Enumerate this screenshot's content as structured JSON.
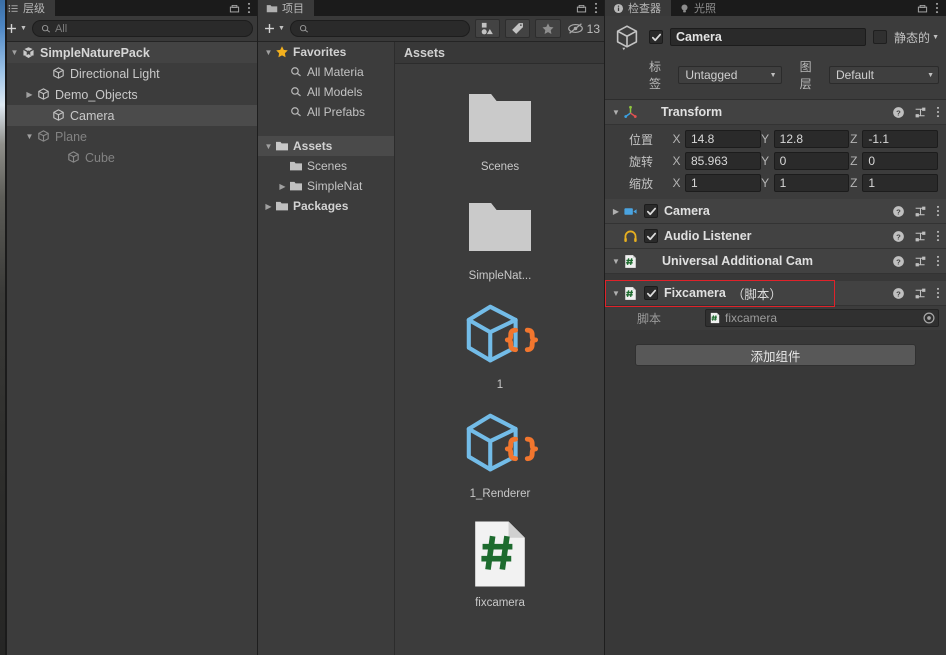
{
  "hierarchy": {
    "tab_label": "层级",
    "tab_icon": "hierarchy-icon",
    "add_label": "+",
    "search_placeholder": "All",
    "search_value": "",
    "items": [
      {
        "label": "SimpleNaturePack",
        "icon": "unity-scene-icon",
        "arrow": "▼",
        "depth": 0,
        "state": "root"
      },
      {
        "label": "Directional Light",
        "icon": "gameobject-cube-icon",
        "arrow": "",
        "depth": 2,
        "state": "normal"
      },
      {
        "label": "Demo_Objects",
        "icon": "gameobject-cube-icon",
        "arrow": "▶",
        "depth": 1,
        "state": "normal"
      },
      {
        "label": "Camera",
        "icon": "gameobject-cube-icon",
        "arrow": "",
        "depth": 2,
        "state": "selected"
      },
      {
        "label": "Plane",
        "icon": "gameobject-cube-icon",
        "arrow": "▼",
        "depth": 1,
        "state": "dim"
      },
      {
        "label": "Cube",
        "icon": "gameobject-cube-icon",
        "arrow": "",
        "depth": 3,
        "state": "dim"
      }
    ]
  },
  "project": {
    "tab_label": "项目",
    "tab_icon": "folder-icon",
    "add_label": "+",
    "search_placeholder": "",
    "search_value": "",
    "toolbar_icons": [
      "type-filter-icon",
      "label-filter-icon",
      "favorites-star-icon"
    ],
    "hidden_count": "13",
    "hidden_icon": "eye-slash-icon",
    "tree": [
      {
        "label": "Favorites",
        "icon": "star-icon",
        "arrow": "▼",
        "depth": 0,
        "bold": true
      },
      {
        "label": "All Materia",
        "icon": "search-icon",
        "arrow": "",
        "depth": 1,
        "bold": false
      },
      {
        "label": "All Models",
        "icon": "search-icon",
        "arrow": "",
        "depth": 1,
        "bold": false
      },
      {
        "label": "All Prefabs",
        "icon": "search-icon",
        "arrow": "",
        "depth": 1,
        "bold": false
      },
      {
        "label": "",
        "icon": "",
        "arrow": "",
        "depth": 0,
        "bold": false
      },
      {
        "label": "Assets",
        "icon": "folder-open-icon",
        "arrow": "▼",
        "depth": 0,
        "bold": true,
        "selected": true
      },
      {
        "label": "Scenes",
        "icon": "folder-icon",
        "arrow": "",
        "depth": 1,
        "bold": false
      },
      {
        "label": "SimpleNat",
        "icon": "folder-icon",
        "arrow": "▶",
        "depth": 1,
        "bold": false
      },
      {
        "label": "Packages",
        "icon": "folder-icon",
        "arrow": "▶",
        "depth": 0,
        "bold": true
      }
    ],
    "breadcrumb": "Assets",
    "assets": [
      {
        "name": "Scenes",
        "icon": "folder-icon"
      },
      {
        "name": "SimpleNat...",
        "icon": "folder-icon"
      },
      {
        "name": "1",
        "icon": "prefab-variant-icon"
      },
      {
        "name": "1_Renderer",
        "icon": "prefab-variant-icon"
      },
      {
        "name": "fixcamera",
        "icon": "csharp-script-icon"
      }
    ]
  },
  "inspector": {
    "tab_label": "检查器",
    "tab_icon": "info-icon",
    "tab2_label": "光照",
    "tab2_icon": "lightbulb-icon",
    "lock_icon": "lock-icon",
    "menu_icon": "kebab-menu-icon",
    "object_enabled": true,
    "object_name": "Camera",
    "static_label": "静态的",
    "static_checked": false,
    "tag_label": "标签",
    "tag_value": "Untagged",
    "layer_label": "图层",
    "layer_value": "Default",
    "transform": {
      "title": "Transform",
      "icon": "transform-axis-icon",
      "expanded": true,
      "rows": [
        {
          "label": "位置",
          "x": "14.8",
          "y": "12.8",
          "z": "-1.1"
        },
        {
          "label": "旋转",
          "x": "85.963",
          "y": "0",
          "z": "0"
        },
        {
          "label": "缩放",
          "x": "1",
          "y": "1",
          "z": "1"
        }
      ],
      "axis_labels": [
        "X",
        "Y",
        "Z"
      ]
    },
    "components": [
      {
        "title": "Camera",
        "icon": "camera-component-icon",
        "arrow": "▶",
        "checkbox": true,
        "checked": true,
        "suffix": "",
        "highlighted": false
      },
      {
        "title": "Audio Listener",
        "icon": "audio-listener-icon",
        "arrow": "",
        "checkbox": true,
        "checked": true,
        "suffix": "",
        "highlighted": false
      },
      {
        "title": "Universal Additional Cam",
        "icon": "csharp-script-icon",
        "arrow": "▼",
        "checkbox": false,
        "checked": false,
        "suffix": "",
        "highlighted": false
      },
      {
        "title": "Fixcamera",
        "icon": "csharp-script-icon",
        "arrow": "▼",
        "checkbox": true,
        "checked": true,
        "suffix": "（脚本）",
        "highlighted": true
      }
    ],
    "script_row": {
      "label": "脚本",
      "value": "fixcamera",
      "icon": "csharp-script-icon",
      "picker_icon": "object-picker-icon"
    },
    "add_component_label": "添加组件",
    "help_icon": "help-icon",
    "preset_icon": "preset-icon",
    "kebab_icon": "kebab-menu-icon"
  },
  "colors": {
    "panel_bg": "#383838",
    "body_bg": "#3c3c3c",
    "header_bg": "#424242",
    "selection": "#4b4b4b",
    "highlight_red": "#e0222a",
    "prefab_blue": "#73bce8",
    "prefab_orange": "#f2762e",
    "script_green": "#1d6b2e",
    "star_gold": "#f2b01e",
    "camera_blue": "#4aa3e0",
    "audio_yellow": "#e8b020",
    "folder_grey": "#c8c8c8"
  }
}
